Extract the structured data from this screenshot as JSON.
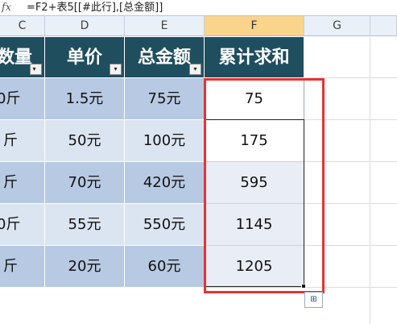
{
  "formula_bar": {
    "fx_label": "fx",
    "formula": "=F2+表5[[#此行],[总金额]]"
  },
  "columns": [
    "C",
    "D",
    "E",
    "F",
    "G"
  ],
  "table": {
    "headers": [
      "数量",
      "单价",
      "总金额",
      "累计求和"
    ],
    "rows": [
      {
        "qty": "0斤",
        "price": "1.5元",
        "total": "75元",
        "cum": "75"
      },
      {
        "qty": "斤",
        "price": "50元",
        "total": "100元",
        "cum": "175"
      },
      {
        "qty": "斤",
        "price": "70元",
        "total": "420元",
        "cum": "595"
      },
      {
        "qty": "0斤",
        "price": "55元",
        "total": "550元",
        "cum": "1145"
      },
      {
        "qty": "斤",
        "price": "20元",
        "total": "60元",
        "cum": "1205"
      }
    ]
  },
  "dropdown_symbol": "▾",
  "autofill_symbol": "⊞",
  "colors": {
    "header_bg": "#1f4e5f",
    "band_dark": "#b7c9e3",
    "band_light": "#dbe5f1",
    "selection": "#e53333"
  }
}
